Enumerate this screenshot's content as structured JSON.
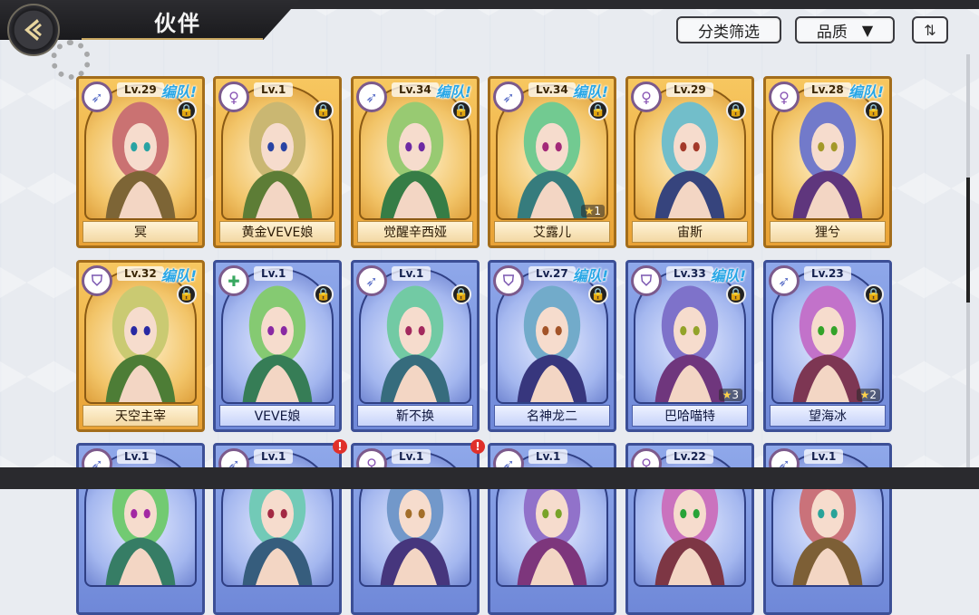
{
  "header": {
    "title": "伙伴",
    "back_icon": "back-arrow-icon",
    "filter_label": "分类筛选",
    "quality_label": "品质",
    "quality_arrow": "▼",
    "sort_icon": "⇅"
  },
  "colors": {
    "gold_frame": "#f2b544",
    "blue_frame": "#7d96e2",
    "team_tag": "#2aa7e6"
  },
  "cards_row1": [
    {
      "name": "冥",
      "level": "Lv.29",
      "team": "编队!",
      "class_icon": "bow-icon",
      "stars": "",
      "rarity": "gold"
    },
    {
      "name": "黄金VEVE娘",
      "level": "Lv.1",
      "team": "",
      "class_icon": "staff-icon",
      "stars": "",
      "rarity": "gold"
    },
    {
      "name": "觉醒辛西娅",
      "level": "Lv.34",
      "team": "编队!",
      "class_icon": "bow-icon",
      "stars": "",
      "rarity": "gold"
    },
    {
      "name": "艾露儿",
      "level": "Lv.34",
      "team": "编队!",
      "class_icon": "bow-icon",
      "stars": "1",
      "rarity": "gold"
    },
    {
      "name": "宙斯",
      "level": "Lv.29",
      "team": "",
      "class_icon": "staff-icon",
      "stars": "",
      "rarity": "gold"
    },
    {
      "name": "狸兮",
      "level": "Lv.28",
      "team": "编队!",
      "class_icon": "staff-icon",
      "stars": "",
      "rarity": "gold"
    }
  ],
  "cards_row2": [
    {
      "name": "天空主宰",
      "level": "Lv.32",
      "team": "编队!",
      "class_icon": "shield-icon",
      "stars": "",
      "rarity": "gold"
    },
    {
      "name": "VEVE娘",
      "level": "Lv.1",
      "team": "",
      "class_icon": "healer-cross-icon",
      "stars": "",
      "rarity": "blue"
    },
    {
      "name": "靳不换",
      "level": "Lv.1",
      "team": "",
      "class_icon": "bow-icon",
      "stars": "",
      "rarity": "blue"
    },
    {
      "name": "名神龙二",
      "level": "Lv.27",
      "team": "编队!",
      "class_icon": "shield-icon",
      "stars": "",
      "rarity": "blue"
    },
    {
      "name": "巴哈喵特",
      "level": "Lv.33",
      "team": "编队!",
      "class_icon": "shield-icon",
      "stars": "3",
      "rarity": "blue"
    },
    {
      "name": "望海冰",
      "level": "Lv.23",
      "team": "",
      "class_icon": "bow-icon",
      "stars": "2",
      "rarity": "blue"
    }
  ],
  "cards_row3": [
    {
      "level": "Lv.1",
      "class_icon": "bow-icon",
      "alert": ""
    },
    {
      "level": "Lv.1",
      "class_icon": "bow-icon",
      "alert": "!"
    },
    {
      "level": "Lv.1",
      "class_icon": "staff-icon",
      "alert": "!"
    },
    {
      "level": "Lv.1",
      "class_icon": "bow-icon",
      "alert": ""
    },
    {
      "level": "Lv.22",
      "class_icon": "staff-icon",
      "alert": ""
    },
    {
      "level": "Lv.1",
      "class_icon": "bow-icon",
      "alert": ""
    }
  ]
}
